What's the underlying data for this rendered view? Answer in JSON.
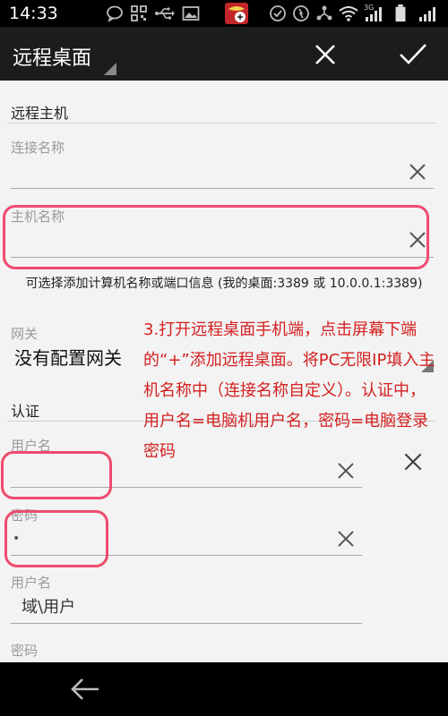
{
  "status_bar": {
    "time": "14:33",
    "network_label": "3G"
  },
  "action_bar": {
    "title": "远程桌面"
  },
  "form": {
    "host_section": "远程主机",
    "connection_name_label": "连接名称",
    "host_name_label": "主机名称",
    "host_hint": "可选择添加计算机名称或端口信息 (我的桌面:3389 或 10.0.0.1:3389)",
    "gateway_label": "网关",
    "gateway_value": "没有配置网关",
    "auth_section": "认证",
    "username_label": "用户名",
    "password_label": "密码",
    "password_value": "•",
    "username2_label": "用户名",
    "domain_user_value": "域\\用户",
    "password2_label": "密码"
  },
  "annotation": {
    "text": "3.打开远程桌面手机端，点击屏幕下端的“+”添加远程桌面。将PC无限IP填入主机名称中（连接名称自定义）。认证中，用户名=电脑机用户名，密码=电脑登录密码"
  },
  "colors": {
    "annotation_red": "#d42020",
    "highlight_box": "#ef4b6e",
    "action_bar_bg": "#1c1c1c"
  }
}
